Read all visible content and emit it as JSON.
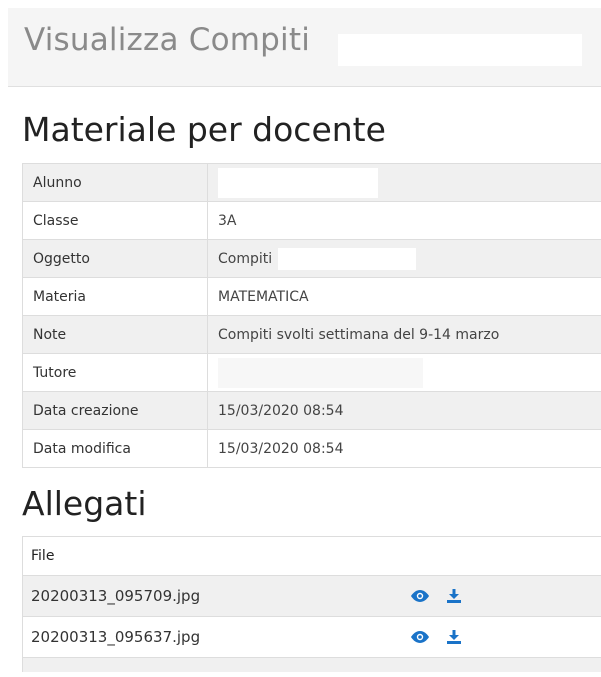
{
  "header": {
    "title": "Visualizza Compiti"
  },
  "section_material": {
    "title": "Materiale per docente",
    "rows": [
      {
        "label": "Alunno",
        "value": ""
      },
      {
        "label": "Classe",
        "value": "3A"
      },
      {
        "label": "Oggetto",
        "value": "Compiti"
      },
      {
        "label": "Materia",
        "value": "MATEMATICA"
      },
      {
        "label": "Note",
        "value": "Compiti svolti settimana del 9-14 marzo"
      },
      {
        "label": "Tutore",
        "value": ""
      },
      {
        "label": "Data creazione",
        "value": "15/03/2020 08:54"
      },
      {
        "label": "Data modifica",
        "value": "15/03/2020 08:54"
      }
    ]
  },
  "section_attachments": {
    "title": "Allegati",
    "column_header": "File",
    "files": [
      {
        "name": "20200313_095709.jpg",
        "view_icon": "eye-icon",
        "download_icon": "download-icon"
      },
      {
        "name": "20200313_095637.jpg",
        "view_icon": "eye-icon",
        "download_icon": "download-icon"
      }
    ]
  },
  "colors": {
    "icon_blue": "#1a73c8",
    "header_text": "#8a8a8a",
    "row_alt": "#f0f0f0"
  }
}
